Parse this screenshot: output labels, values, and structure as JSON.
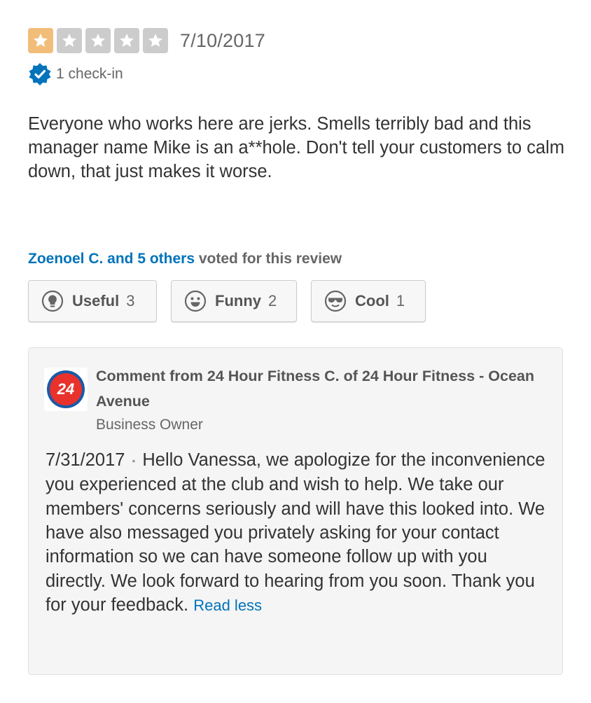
{
  "review": {
    "rating": 1,
    "max_rating": 5,
    "date": "7/10/2017",
    "checkin": "1 check-in",
    "text": "Everyone who works here are jerks. Smells terribly bad and this manager name Mike is an a**hole. Don't tell your customers to calm down, that just makes it worse."
  },
  "votes": {
    "voters_link": "Zoenoel C. and 5 others",
    "suffix": " voted for this review",
    "buttons": [
      {
        "label": "Useful",
        "count": "3",
        "icon": "lightbulb-icon"
      },
      {
        "label": "Funny",
        "count": "2",
        "icon": "smiley-icon"
      },
      {
        "label": "Cool",
        "count": "1",
        "icon": "sunglasses-icon"
      }
    ]
  },
  "comment": {
    "logo_text": "24",
    "title": "Comment from 24 Hour Fitness C. of 24 Hour Fitness - Ocean Avenue",
    "role": "Business Owner",
    "date": "7/31/2017",
    "separator": "•",
    "text": "Hello Vanessa, we apologize for the inconvenience you experienced at the club and wish to help. We take our members' concerns seriously and will have this looked into. We have also messaged you privately asking for your contact information so we can have someone follow up with you directly. We look forward to hearing from you soon. Thank you for your feedback.",
    "read_less": "Read less"
  },
  "colors": {
    "star_filled": "#f2bd79",
    "star_empty": "#cccccc",
    "link": "#0073bb",
    "checkin_badge": "#0073bb"
  }
}
